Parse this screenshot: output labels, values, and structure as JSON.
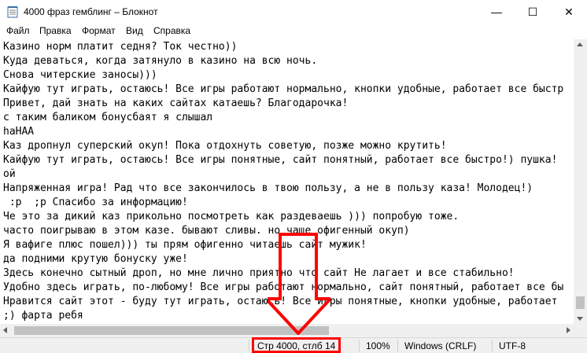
{
  "window": {
    "title": "4000 фраз гемблинг – Блокнот",
    "minimize_glyph": "—",
    "maximize_glyph": "☐",
    "close_glyph": "✕"
  },
  "menu": {
    "items": [
      {
        "label": "Файл"
      },
      {
        "label": "Правка"
      },
      {
        "label": "Формат"
      },
      {
        "label": "Вид"
      },
      {
        "label": "Справка"
      }
    ]
  },
  "editor": {
    "lines": [
      "Казино норм платит седня? Ток честно))",
      "Куда деваться, когда затянуло в казино на всю ночь.",
      "Снова читерские заносы)))",
      "Кайфую тут играть, остаюсь! Все игры работают нормально, кнопки удобные, работает все быстр",
      "Привет, дай знать на каких сайтах катаешь? Благодарочка!",
      "с таким баликом бонусбаят я слышал",
      "haHAA",
      "Каз дропнул суперский окуп! Пока отдохнуть советую, позже можно крутить!",
      "Кайфую тут играть, остаюсь! Все игры понятные, сайт понятный, работает все быстро!) пушка!",
      "ой",
      "Напряженная игра! Рад что все закончилось в твою пользу, а не в пользу каза! Молодец!)",
      " :p  ;p Спасибо за информацию!",
      "Че это за дикий каз прикольно посмотреть как раздеваешь ))) попробую тоже.",
      "часто поигрываю в этом казе. бывают сливы. но чаще офигенный окуп)",
      "Я вафиге плюс пошел))) ты прям офигенно читаешь сайт мужик!",
      "да подними крутую бонуску уже!",
      "Здесь конечно сытный дроп, но мне лично приятно что сайт Не лагает и все стабильно!",
      "Удобно здесь играть, по-любому! Все игры работают нормально, сайт понятный, работает все бы",
      "Нравится сайт этот - буду тут играть, остаюсь! Все игры понятные, кнопки удобные, работает",
      ";) фарта ребя"
    ]
  },
  "status": {
    "position": "Стр 4000, стлб 14",
    "zoom": "100%",
    "line_endings": "Windows (CRLF)",
    "encoding": "UTF-8"
  },
  "annotation": {
    "color": "#ff0000"
  }
}
